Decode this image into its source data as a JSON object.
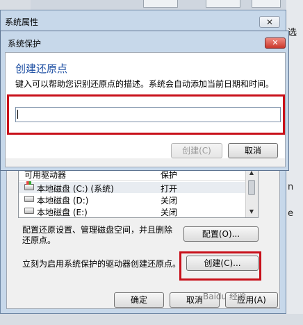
{
  "outer_dialog": {
    "title": "系统属性",
    "close_glyph": "✕",
    "drive_list": {
      "headers": [
        "可用驱动器",
        "保护"
      ],
      "rows": [
        {
          "name": "本地磁盘 (C:) (系统)",
          "status": "打开",
          "icon": "system-drive-icon"
        },
        {
          "name": "本地磁盘 (D:)",
          "status": "关闭",
          "icon": "drive-icon"
        },
        {
          "name": "本地磁盘 (E:)",
          "status": "关闭",
          "icon": "drive-icon"
        }
      ]
    },
    "configure_text": "配置还原设置、管理磁盘空间，并且删除还原点。",
    "configure_button": "配置(O)...",
    "create_text": "立刻为启用系统保护的驱动器创建还原点。",
    "create_button": "创建(C)...",
    "ok_button": "确定",
    "cancel_button": "取消",
    "apply_button": "应用(A)"
  },
  "inner_dialog": {
    "title": "系统保护",
    "close_glyph": "✕",
    "heading": "创建还原点",
    "instruction": "键入可以帮助您识别还原点的描述。系统会自动添加当前日期和时间。",
    "input_value": "",
    "create_button": "创建(C)",
    "cancel_button": "取消"
  },
  "background": {
    "right_peek_text": "选",
    "right_peek_text_2": "n",
    "right_peek_text_3": "e"
  },
  "watermark": "Baidu 经验",
  "colors": {
    "highlight_red": "#c8101a",
    "heading_blue": "#1e4fa3"
  }
}
